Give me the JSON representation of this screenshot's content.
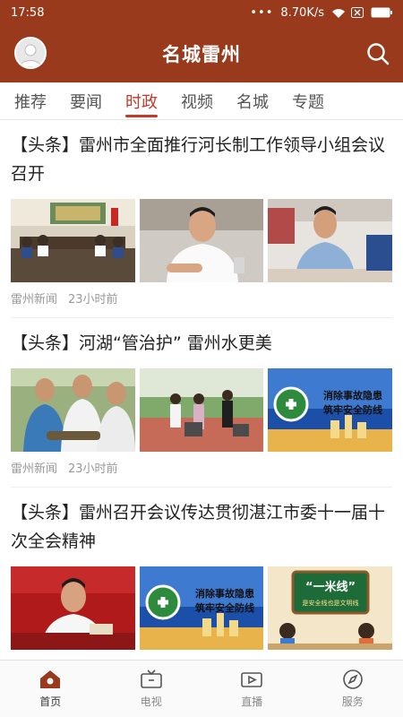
{
  "status_bar": {
    "time": "17:58",
    "dots": "•••",
    "speed": "8.70K/s",
    "notif": "✕"
  },
  "header": {
    "title": "名城雷州"
  },
  "tabs": [
    {
      "label": "推荐"
    },
    {
      "label": "要闻"
    },
    {
      "label": "时政",
      "active": true
    },
    {
      "label": "视频"
    },
    {
      "label": "名城"
    },
    {
      "label": "专题"
    }
  ],
  "articles": [
    {
      "title": "【头条】雷州市全面推行河长制工作领导小组会议召开",
      "source": "雷州新闻",
      "time": "23小时前"
    },
    {
      "title": "【头条】河湖“管治护” 雷州水更美",
      "source": "雷州新闻",
      "time": "23小时前",
      "poster_text_line1": "消除事故隐患",
      "poster_text_line2": "筑牢安全防线"
    },
    {
      "title": "【头条】雷州召开会议传达贯彻湛江市委十一届十次全会精神",
      "poster_text_line1": "消除事故隐患",
      "poster_text_line2": "筑牢安全防线",
      "board_title": "“一米线”",
      "board_sub": "是安全线也是文明线"
    }
  ],
  "bottom_nav": [
    {
      "label": "首页",
      "icon": "home-icon",
      "active": true
    },
    {
      "label": "电视",
      "icon": "tv-icon"
    },
    {
      "label": "直播",
      "icon": "live-video-icon"
    },
    {
      "label": "服务",
      "icon": "compass-icon"
    }
  ],
  "colors": {
    "brand": "#9a3a1c",
    "active_tab": "#c0392b"
  }
}
